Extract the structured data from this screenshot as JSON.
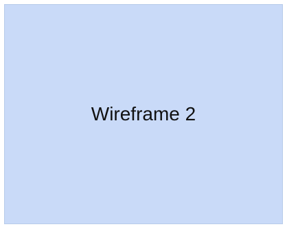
{
  "wireframe": {
    "label": "Wireframe 2"
  },
  "colors": {
    "panel_fill": "#c9daf8",
    "panel_border": "#b7cbe9",
    "text": "#111111",
    "background": "#ffffff"
  }
}
